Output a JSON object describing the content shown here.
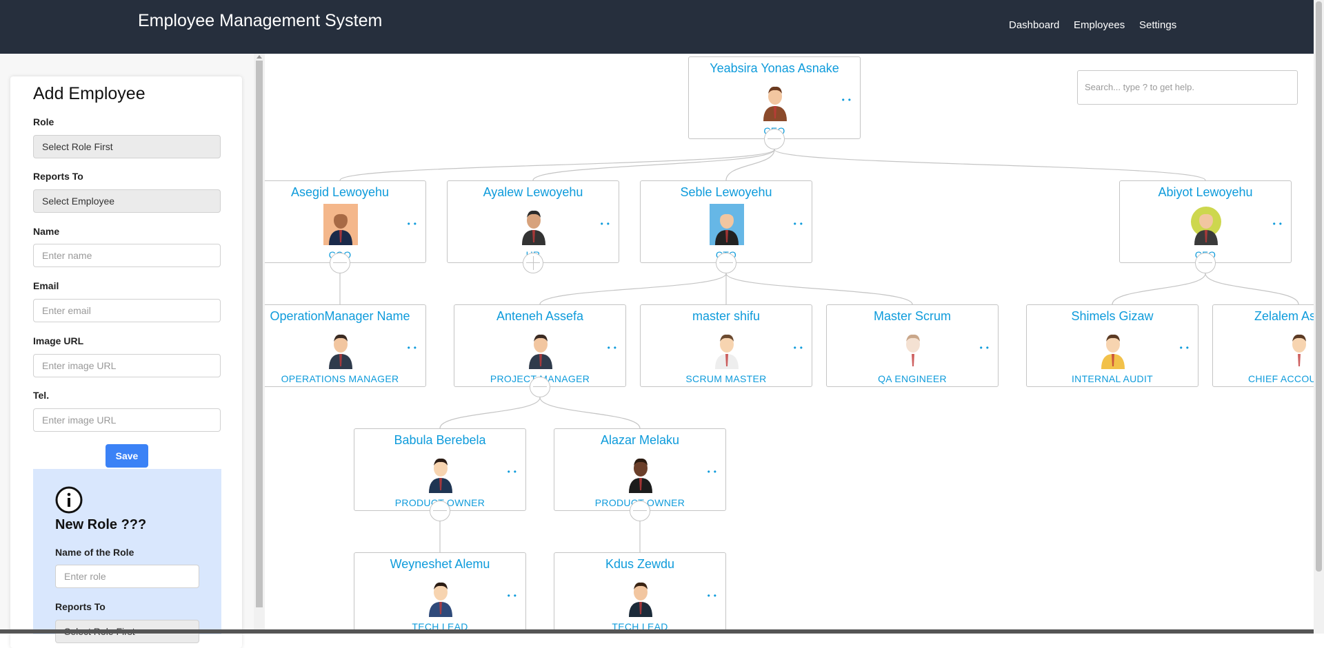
{
  "navbar": {
    "brand": "Employee Management System",
    "links": [
      "Dashboard",
      "Employees",
      "Settings"
    ]
  },
  "sidebar": {
    "title": "Add Employee",
    "role_label": "Role",
    "role_select": "Select Role First",
    "reports_to_label": "Reports To",
    "reports_to_select": "Select Employee",
    "name_label": "Name",
    "name_placeholder": "Enter name",
    "email_label": "Email",
    "email_placeholder": "Enter email",
    "image_label": "Image URL",
    "image_placeholder": "Enter image URL",
    "tel_label": "Tel.",
    "tel_placeholder": "Enter image URL",
    "save_label": "Save",
    "new_role": {
      "title": "New Role ???",
      "name_label": "Name of the Role",
      "name_placeholder": "Enter role",
      "reports_to_label": "Reports To",
      "reports_to_select": "Select Role First"
    }
  },
  "chart": {
    "search_placeholder": "Search... type ? to get help.",
    "nodes": [
      {
        "name": "Yeabsira Yonas Asnake",
        "role": "CEO",
        "avatar": "bearded-man-brown-suit"
      },
      {
        "name": "Asegid Lewoyehu",
        "role": "COO",
        "avatar": "woman-orange-background"
      },
      {
        "name": "Ayalew Lewoyehu",
        "role": "HR",
        "avatar": "man-dark-suit"
      },
      {
        "name": "Seble Lewoyehu",
        "role": "CTO",
        "avatar": "woman-glasses-blue-background"
      },
      {
        "name": "Abiyot Lewoyehu",
        "role": "CFO",
        "avatar": "bearded-man-round-frame"
      },
      {
        "name": "OperationManager Name",
        "role": "OPERATIONS MANAGER",
        "avatar": "man-phone"
      },
      {
        "name": "Anteneh Assefa",
        "role": "PROJECT MANAGER",
        "avatar": "man-phone"
      },
      {
        "name": "master shifu",
        "role": "SCRUM MASTER",
        "avatar": "cartoon-man"
      },
      {
        "name": "Master Scrum",
        "role": "QA ENGINEER",
        "avatar": "woman-sketch"
      },
      {
        "name": "Shimels Gizaw",
        "role": "INTERNAL AUDIT",
        "avatar": "man-yellow-shirt"
      },
      {
        "name": "Zelalem Asnake",
        "role": "CHIEF ACCOUNTANT",
        "avatar": "man-waving"
      },
      {
        "name": "Babula Berebela",
        "role": "PRODUCT OWNER",
        "avatar": "man-blue-tie"
      },
      {
        "name": "Alazar Melaku",
        "role": "PRODUCT OWNER",
        "avatar": "man-red-tie"
      },
      {
        "name": "Weyneshet Alemu",
        "role": "TECH LEAD",
        "avatar": "woman-glasses"
      },
      {
        "name": "Kdus Zewdu",
        "role": "TECH LEAD",
        "avatar": "bearded-man-teal-tie"
      }
    ]
  },
  "colors": {
    "navbar": "#262f3d",
    "accent_text": "#0e9bdb",
    "save_button": "#3b82f6",
    "info_panel": "#d9e7fd"
  }
}
